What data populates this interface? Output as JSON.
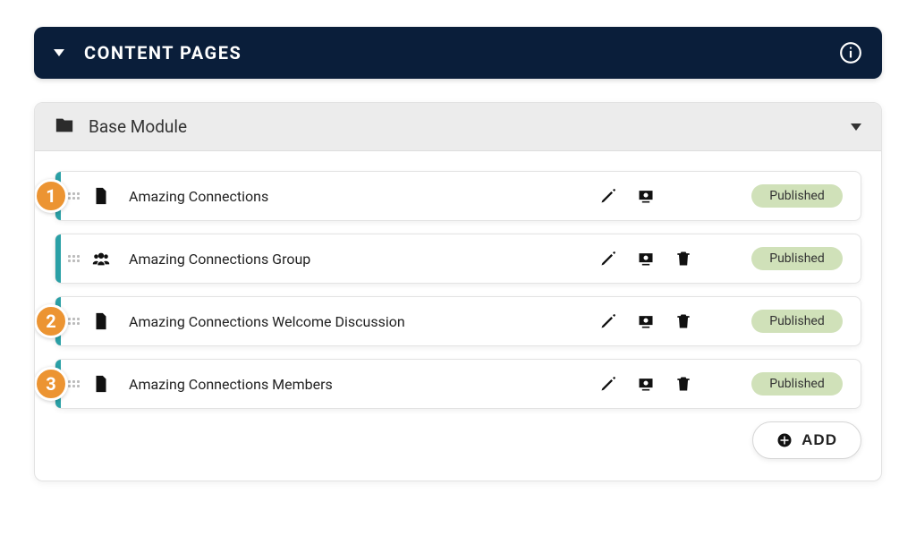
{
  "panel": {
    "title": "CONTENT PAGES"
  },
  "module": {
    "title": "Base Module",
    "add_label": "ADD",
    "pages": [
      {
        "title": "Amazing Connections",
        "type": "document",
        "status": "Published",
        "can_delete": false,
        "badge": "1"
      },
      {
        "title": "Amazing Connections Group",
        "type": "group",
        "status": "Published",
        "can_delete": true,
        "badge": ""
      },
      {
        "title": "Amazing Connections Welcome Discussion",
        "type": "document",
        "status": "Published",
        "can_delete": true,
        "badge": "2"
      },
      {
        "title": "Amazing Connections Members",
        "type": "document",
        "status": "Published",
        "can_delete": true,
        "badge": "3"
      }
    ]
  }
}
